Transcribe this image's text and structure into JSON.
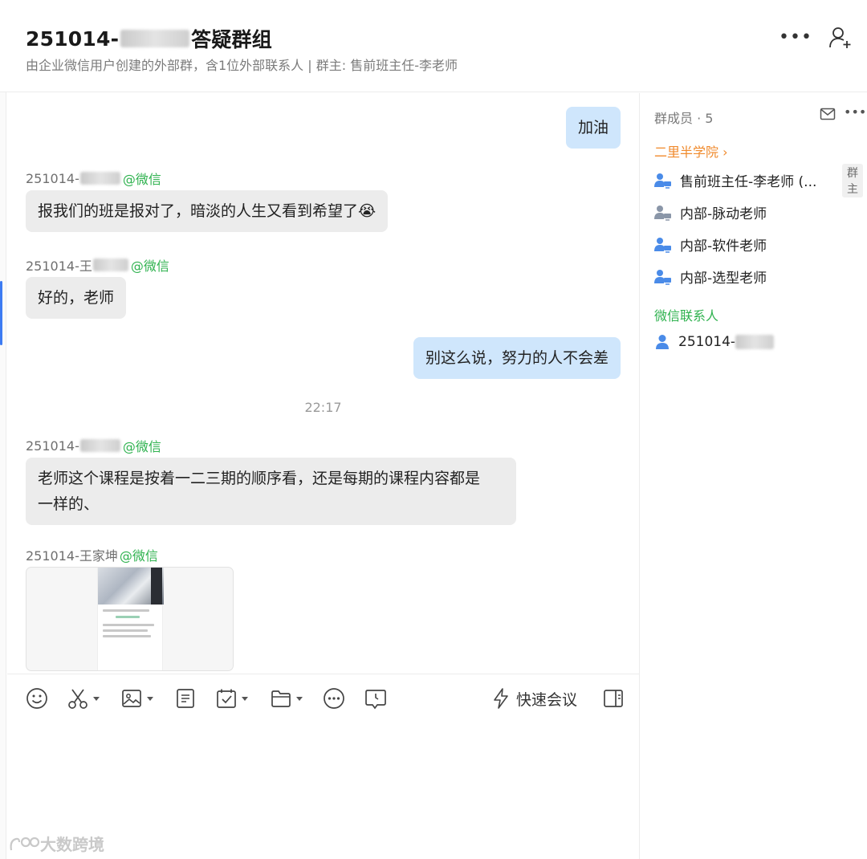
{
  "header": {
    "title_prefix": "251014-",
    "title_suffix": "答疑群组",
    "subtitle": "由企业微信用户创建的外部群，含1位外部联系人 | 群主: 售前班主任-李老师"
  },
  "messages": {
    "m1": {
      "text": "加油"
    },
    "m2": {
      "sender": "251014-",
      "source": "@微信",
      "text": "报我们的班是报对了，暗淡的人生又看到希望了😭"
    },
    "m3": {
      "sender": "251014-王",
      "source": "@微信",
      "text": "好的，老师"
    },
    "m4": {
      "text": "别这么说，努力的人不会差"
    },
    "time": "22:17",
    "m5": {
      "sender": "251014-",
      "source": "@微信",
      "text_line1": "老师这个课程是按着一二三期的顺序看，还是每期的课程内容都是",
      "text_line2": "一样的、"
    },
    "m6": {
      "sender": "251014-王家坤",
      "source": "@微信"
    }
  },
  "toolbar": {
    "quick_meeting": "快速会议",
    "icons": [
      "emoji-icon",
      "scissors-icon",
      "image-icon",
      "document-icon",
      "calendar-check-icon",
      "folder-icon",
      "more-circle-icon",
      "clock-bubble-icon",
      "side-panel-icon",
      "lightning-icon"
    ]
  },
  "side": {
    "members_title": "群成员 · 5",
    "org_group": "二里半学院 ›",
    "members": [
      {
        "name": "售前班主任-李老师 (...",
        "badge": "群主"
      },
      {
        "name": "内部-脉动老师"
      },
      {
        "name": "内部-软件老师"
      },
      {
        "name": "内部-选型老师"
      }
    ],
    "wechat_group": "微信联系人",
    "wechat_contact": "251014-"
  },
  "watermark": "大数跨境",
  "colors": {
    "accent_blue": "#3d7bf2",
    "wechat_green": "#2fb24f",
    "org_orange": "#f08a2c",
    "outgoing_bubble": "#cfe6fc",
    "incoming_bubble": "#ececec"
  }
}
